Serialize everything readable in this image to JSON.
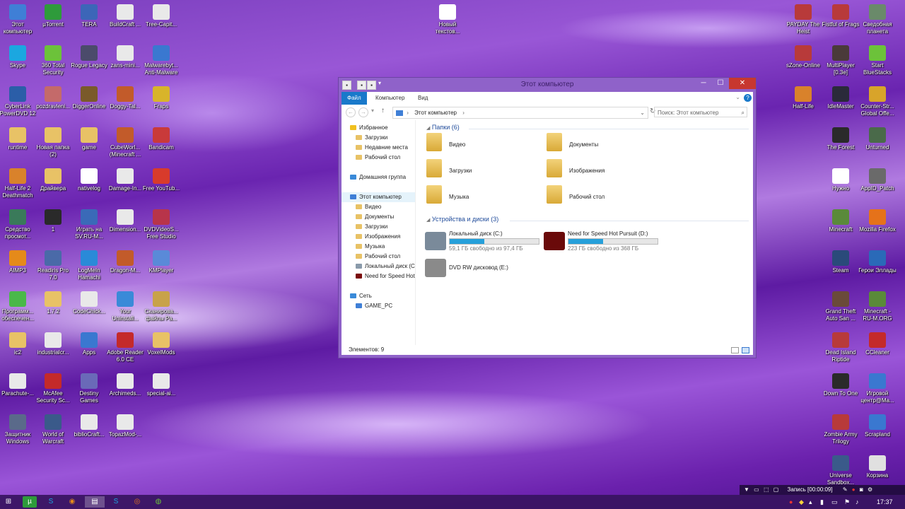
{
  "desktop_left": [
    {
      "label": "Этот компьютер",
      "icon": "computer-icon",
      "color": "#3f7fd6"
    },
    {
      "label": "µTorrent",
      "icon": "utorrent-icon",
      "color": "#2e9b3b"
    },
    {
      "label": "TERA",
      "icon": "tera-icon",
      "color": "#3c66b8"
    },
    {
      "label": "BuildCraft ...",
      "icon": "java-file-icon",
      "color": "#e9e9e9"
    },
    {
      "label": "Tree-Capit...",
      "icon": "java-file-icon",
      "color": "#e9e9e9"
    },
    {
      "label": "Skype",
      "icon": "skype-icon",
      "color": "#1ba7e0"
    },
    {
      "label": "360 Total Security",
      "icon": "shield-icon",
      "color": "#6cc23a"
    },
    {
      "label": "Rogue Legacy",
      "icon": "game-icon",
      "color": "#4b4b6b"
    },
    {
      "label": "zans-mini...",
      "icon": "java-file-icon",
      "color": "#e9e9e9"
    },
    {
      "label": "Malwarebyt... Anti-Malware",
      "icon": "malwarebytes-icon",
      "color": "#3a78d0"
    },
    {
      "label": "CyberLink PowerDVD 12",
      "icon": "dvd-icon",
      "color": "#2b5ea8"
    },
    {
      "label": "pozdravleni...",
      "icon": "image-icon",
      "color": "#c46a6a"
    },
    {
      "label": "DiggerOnline",
      "icon": "game-icon",
      "color": "#7a5a2a"
    },
    {
      "label": "Doggy-Tal...",
      "icon": "archive-icon",
      "color": "#c25b2a"
    },
    {
      "label": "Fraps",
      "icon": "fraps-icon",
      "color": "#d8b42a"
    },
    {
      "label": "runtime",
      "icon": "folder-icon",
      "color": "#e8c266"
    },
    {
      "label": "Новая папка (2)",
      "icon": "folder-icon",
      "color": "#e8c266"
    },
    {
      "label": "game",
      "icon": "folder-icon",
      "color": "#e8c266"
    },
    {
      "label": "CubeWorl... (Minecraft ...",
      "icon": "archive-icon",
      "color": "#c25b2a"
    },
    {
      "label": "Bandicam",
      "icon": "bandicam-icon",
      "color": "#c93a3a"
    },
    {
      "label": "Half-Life 2 Deathmatch",
      "icon": "game-icon",
      "color": "#d9822b"
    },
    {
      "label": "Драйвера",
      "icon": "folder-icon",
      "color": "#e8c266"
    },
    {
      "label": "nativelog",
      "icon": "text-file-icon",
      "color": "#ffffff"
    },
    {
      "label": "Damage-In...",
      "icon": "java-file-icon",
      "color": "#e9e9e9"
    },
    {
      "label": "Free YouTub...",
      "icon": "youtube-icon",
      "color": "#d83b2b"
    },
    {
      "label": "Средство просмот...",
      "icon": "viewer-icon",
      "color": "#3a7a5a"
    },
    {
      "label": "1",
      "icon": "image-icon",
      "color": "#2a2a2a"
    },
    {
      "label": "Играть на SV.RU-M...",
      "icon": "game-icon",
      "color": "#3a6ab8"
    },
    {
      "label": "Dimension...",
      "icon": "java-file-icon",
      "color": "#e9e9e9"
    },
    {
      "label": "DVDVideoS... Free Studio",
      "icon": "dvdvideosoft-icon",
      "color": "#b8344a"
    },
    {
      "label": "AIMP3",
      "icon": "aimp-icon",
      "color": "#e58a1a"
    },
    {
      "label": "Readiris Pro 7.0",
      "icon": "readiris-icon",
      "color": "#4a6aa8"
    },
    {
      "label": "LogMeIn Hamachi",
      "icon": "hamachi-icon",
      "color": "#2a8ad8"
    },
    {
      "label": "Dragon-M...",
      "icon": "archive-icon",
      "color": "#c25b2a"
    },
    {
      "label": "KMPlayer",
      "icon": "kmplayer-icon",
      "color": "#5a8ad8"
    },
    {
      "label": "Программ... обеспечен...",
      "icon": "programs-icon",
      "color": "#4ab84a"
    },
    {
      "label": "1.7.2",
      "icon": "folder-icon",
      "color": "#e8c266"
    },
    {
      "label": "CodeChick...",
      "icon": "java-file-icon",
      "color": "#e9e9e9"
    },
    {
      "label": "Your Uninstall...",
      "icon": "uninstall-icon",
      "color": "#3a8ad8"
    },
    {
      "label": "Сканирова... файлы Ра...",
      "icon": "scan-icon",
      "color": "#c8a24a"
    },
    {
      "label": "ic2",
      "icon": "folder-icon",
      "color": "#e8c266"
    },
    {
      "label": "industrialcr...",
      "icon": "java-file-icon",
      "color": "#e9e9e9"
    },
    {
      "label": "Apps",
      "icon": "apps-icon",
      "color": "#3a78d0"
    },
    {
      "label": "Adobe Reader 6.0 CE",
      "icon": "adobe-reader-icon",
      "color": "#c42a2a"
    },
    {
      "label": "VoxelMods",
      "icon": "folder-icon",
      "color": "#e8c266"
    },
    {
      "label": "Parachute-...",
      "icon": "java-file-icon",
      "color": "#e9e9e9"
    },
    {
      "label": "McAfee Security Sc...",
      "icon": "mcafee-icon",
      "color": "#c42a2a"
    },
    {
      "label": "Destiny Games",
      "icon": "game-icon",
      "color": "#6a6ab8"
    },
    {
      "label": "Archimeds...",
      "icon": "java-file-icon",
      "color": "#e9e9e9"
    },
    {
      "label": "special-ai...",
      "icon": "java-file-icon",
      "color": "#e9e9e9"
    },
    {
      "label": "Защитник Windows",
      "icon": "defender-icon",
      "color": "#5a6a8a"
    },
    {
      "label": "World of Warcraft",
      "icon": "game-icon",
      "color": "#3a5a8a"
    },
    {
      "label": "biblioCraft...",
      "icon": "java-file-icon",
      "color": "#e9e9e9"
    },
    {
      "label": "TopazMod-...",
      "icon": "java-file-icon",
      "color": "#e9e9e9"
    }
  ],
  "desktop_top_middle": {
    "label": "Новый текстов...",
    "icon": "text-file-icon",
    "color": "#ffffff"
  },
  "desktop_right": [
    {
      "label": "PAYDAY The Heist",
      "icon": "game-icon",
      "color": "#b83a3a"
    },
    {
      "label": "Fistful of Frags",
      "icon": "game-icon",
      "color": "#b83a3a"
    },
    {
      "label": "Сведобная планета",
      "icon": "game-icon",
      "color": "#6a8a6a"
    },
    {
      "label": "sZone-Online",
      "icon": "game-icon",
      "color": "#b83a3a"
    },
    {
      "label": "MultiPlayer [0.3e]",
      "icon": "game-icon",
      "color": "#4a3a3a"
    },
    {
      "label": "Start BlueStacks",
      "icon": "bluestacks-icon",
      "color": "#6cc23a"
    },
    {
      "label": "Half-Life",
      "icon": "half-life-icon",
      "color": "#d9822b"
    },
    {
      "label": "IdleMaster",
      "icon": "idlemaster-icon",
      "color": "#2a2a3a"
    },
    {
      "label": "Counter-Str... Global Offe...",
      "icon": "csgo-icon",
      "color": "#d8a42a"
    },
    {
      "label": "The Forest",
      "icon": "game-icon",
      "color": "#2a2a2a"
    },
    {
      "label": "Unturned",
      "icon": "game-icon",
      "color": "#4a6a4a"
    },
    {
      "label": "Нужно",
      "icon": "folder-icon",
      "color": "#ffffff"
    },
    {
      "label": "AppID_Patch",
      "icon": "settings-icon",
      "color": "#6a6a6a"
    },
    {
      "label": "Minecraft",
      "icon": "minecraft-icon",
      "color": "#5a8a3a"
    },
    {
      "label": "Mozilla Firefox",
      "icon": "firefox-icon",
      "color": "#e5721a"
    },
    {
      "label": "Steam",
      "icon": "steam-icon",
      "color": "#2a4a7a"
    },
    {
      "label": "Герои Эллады",
      "icon": "game-icon",
      "color": "#2a6ab8"
    },
    {
      "label": "Grand Theft Auto San ...",
      "icon": "gta-icon",
      "color": "#6a4a3a"
    },
    {
      "label": "Minecraft - RU-M.ORG",
      "icon": "minecraft-icon",
      "color": "#5a8a3a"
    },
    {
      "label": "Dead Island Riptide",
      "icon": "game-icon",
      "color": "#b83a3a"
    },
    {
      "label": "CCleaner",
      "icon": "ccleaner-icon",
      "color": "#c42a2a"
    },
    {
      "label": "Down To One",
      "icon": "game-icon",
      "color": "#2a2a2a"
    },
    {
      "label": "Игровой центр@Ma...",
      "icon": "game-center-icon",
      "color": "#3a78d0"
    },
    {
      "label": "Zombie Army Trilogy",
      "icon": "game-icon",
      "color": "#b83a3a"
    },
    {
      "label": "Scrapland",
      "icon": "game-icon",
      "color": "#3a78d0"
    },
    {
      "label": "Universe Sandbox...",
      "icon": "game-icon",
      "color": "#3a5a8a"
    },
    {
      "label": "Корзина",
      "icon": "recycle-bin-icon",
      "color": "#e0e0e0"
    }
  ],
  "window": {
    "title": "Этот компьютер",
    "tabs": [
      "Файл",
      "Компьютер",
      "Вид"
    ],
    "breadcrumb": "Этот компьютер",
    "search_placeholder": "Поиск: Этот компьютер",
    "nav": {
      "favorites": "Избранное",
      "favorites_items": [
        "Загрузки",
        "Недавние места",
        "Рабочий стол"
      ],
      "homegroup": "Домашняя группа",
      "this_pc": "Этот компьютер",
      "this_pc_items": [
        "Видео",
        "Документы",
        "Загрузки",
        "Изображения",
        "Музыка",
        "Рабочий стол",
        "Локальный диск (C",
        "Need for Speed Hot"
      ],
      "network": "Сеть",
      "network_items": [
        "GAME_PC"
      ]
    },
    "folders_header": "Папки (6)",
    "folders": [
      "Видео",
      "Документы",
      "Загрузки",
      "Изображения",
      "Музыка",
      "Рабочий стол"
    ],
    "drives_header": "Устройства и диски (3)",
    "drives": [
      {
        "name": "Локальный диск (C:)",
        "free": "59,1 ГБ свободно из 97,4 ГБ",
        "used_fraction": 0.39,
        "icon": "hdd-icon",
        "color": "#7a8a9a"
      },
      {
        "name": "Need for Speed Hot Pursuit (D:)",
        "free": "223 ГБ свободно из 368 ГБ",
        "used_fraction": 0.39,
        "icon": "nfs-drive-icon",
        "color": "#6a0a0a"
      },
      {
        "name": "DVD RW дисковод (E:)",
        "icon": "dvd-drive-icon",
        "color": "#8a8a8a"
      }
    ],
    "status": "Элементов: 9"
  },
  "recording": {
    "label": "Запись [00:00:09]"
  },
  "clock": "17:37"
}
